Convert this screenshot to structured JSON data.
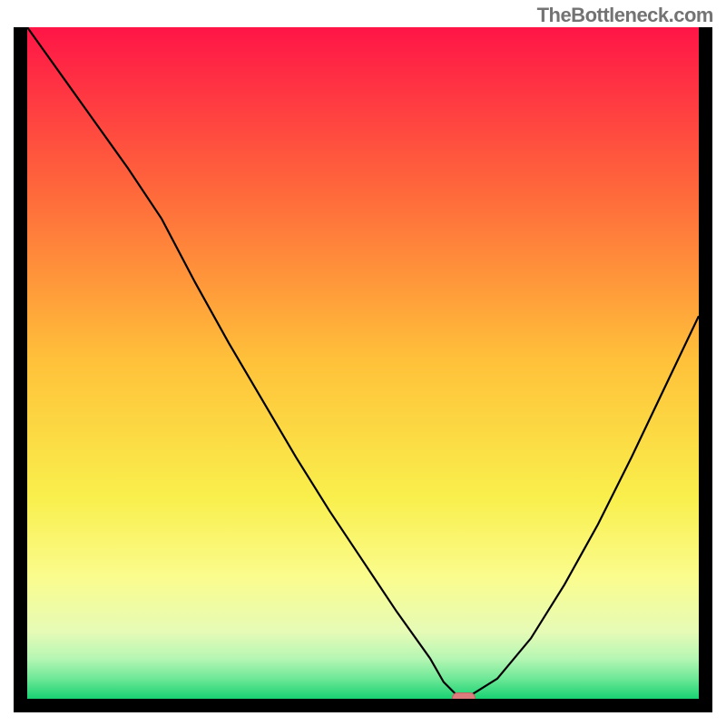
{
  "watermark": "TheBottleneck.com",
  "chart_data": {
    "type": "line",
    "title": "",
    "xlabel": "",
    "ylabel": "",
    "xlim": [
      0,
      100
    ],
    "ylim": [
      0,
      100
    ],
    "x": [
      0,
      5,
      10,
      15,
      20,
      25,
      30,
      35,
      40,
      45,
      50,
      55,
      60,
      62,
      64,
      66,
      70,
      75,
      80,
      85,
      90,
      95,
      100
    ],
    "values": [
      100,
      93,
      86,
      79,
      71.5,
      62,
      53,
      44.5,
      36,
      28,
      20.5,
      13,
      6,
      2.5,
      0.5,
      0.5,
      3,
      9,
      17,
      26,
      36,
      46.5,
      57
    ],
    "marker": {
      "x": 65,
      "y": 0
    },
    "gradient_stops": [
      {
        "offset": 0,
        "color": "#FF1547"
      },
      {
        "offset": 0.25,
        "color": "#FF6A3B"
      },
      {
        "offset": 0.5,
        "color": "#FFC23A"
      },
      {
        "offset": 0.7,
        "color": "#F9EF4C"
      },
      {
        "offset": 0.82,
        "color": "#FAFC8E"
      },
      {
        "offset": 0.9,
        "color": "#E6FBB6"
      },
      {
        "offset": 0.94,
        "color": "#B6F6B4"
      },
      {
        "offset": 0.97,
        "color": "#6EE897"
      },
      {
        "offset": 1.0,
        "color": "#18D272"
      }
    ]
  }
}
